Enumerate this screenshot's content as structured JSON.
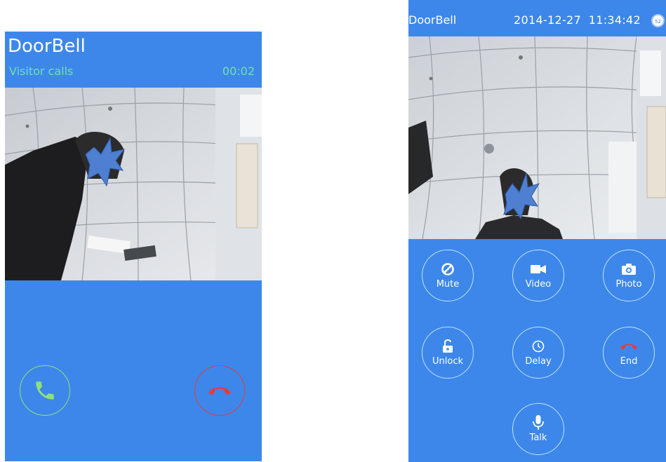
{
  "incoming": {
    "app_title": "DoorBell",
    "status": "Visitor calls",
    "timer": "00:02"
  },
  "in_call": {
    "app_title": "DoorBell",
    "datetime": "2014-12-27  11:34:42",
    "badge": "52",
    "controls": {
      "mute": "Mute",
      "video": "Video",
      "photo": "Photo",
      "unlock": "Unlock",
      "delay": "Delay",
      "end": "End",
      "talk": "Talk"
    }
  },
  "colors": {
    "screen_bg": "#3d87ea",
    "status_text": "#6fe3a4",
    "answer": "#8ee07a",
    "reject": "#e53b3b"
  }
}
